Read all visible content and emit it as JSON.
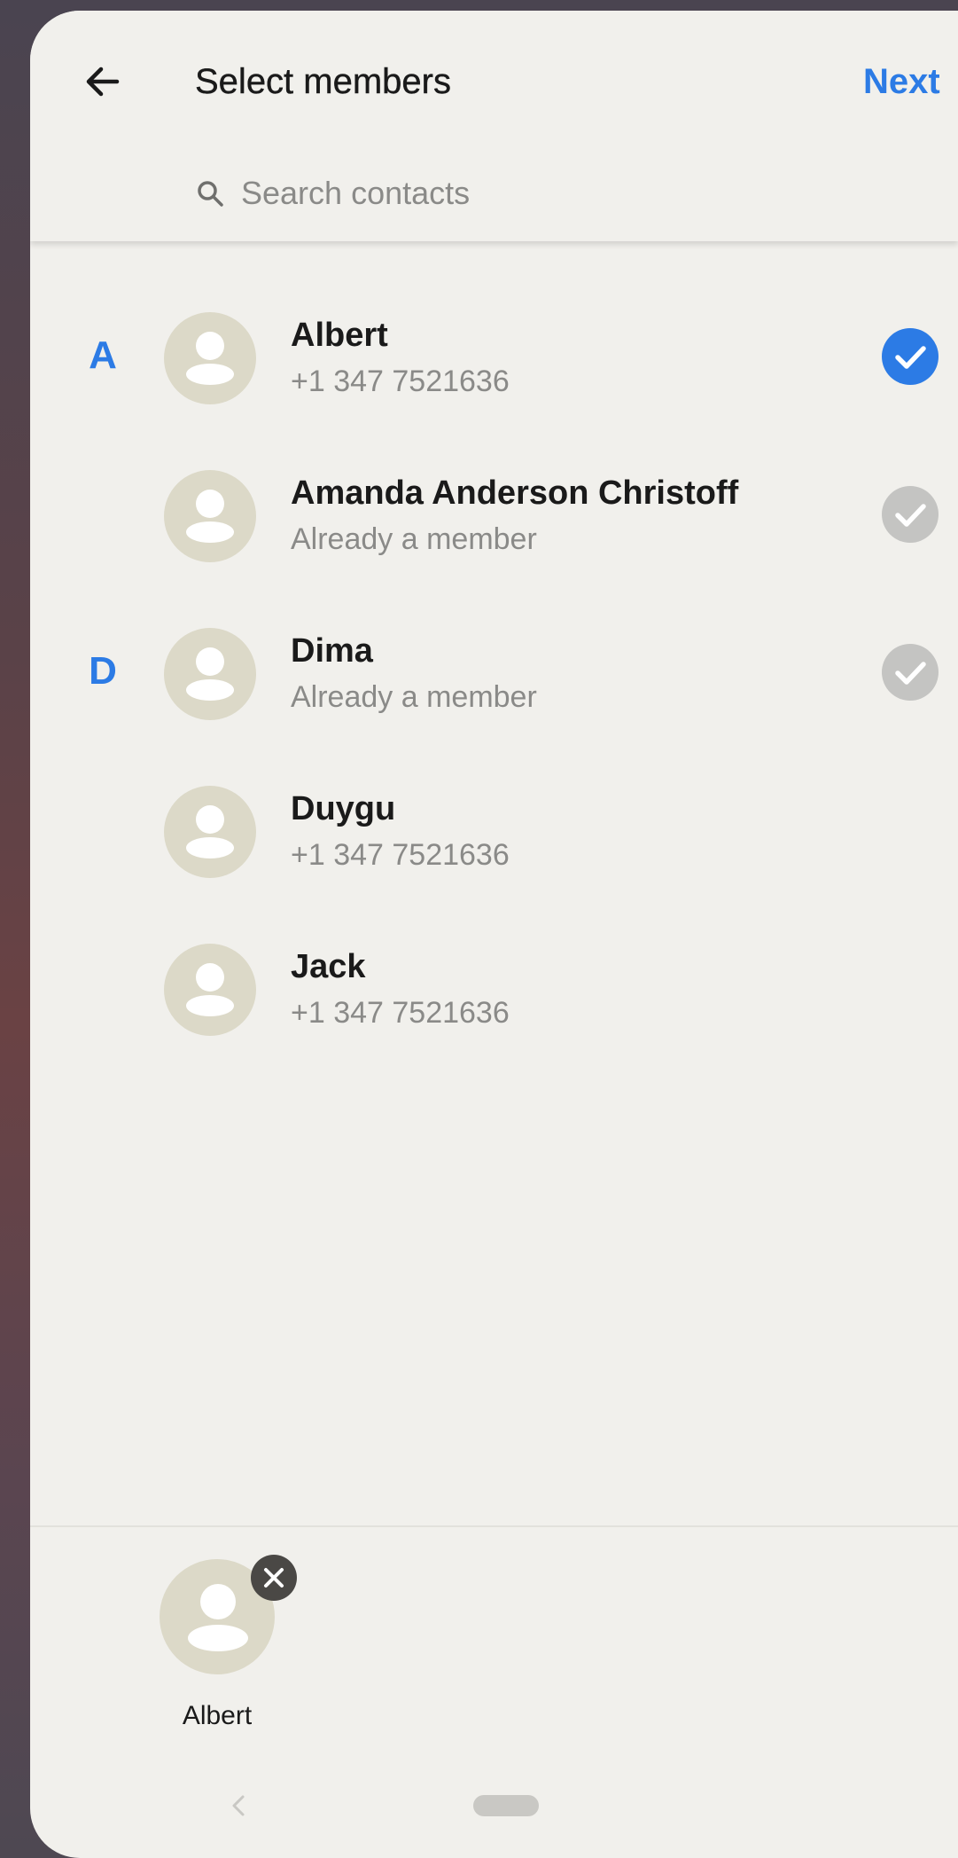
{
  "header": {
    "title": "Select members",
    "next_label": "Next",
    "search_placeholder": "Search contacts"
  },
  "sections": [
    {
      "letter": "A"
    },
    {
      "letter": "D"
    }
  ],
  "contacts": [
    {
      "name": "Albert",
      "subtitle": "+1 347 7521636",
      "state": "selected"
    },
    {
      "name": "Amanda Anderson Christoff",
      "subtitle": "Already a member",
      "state": "member"
    },
    {
      "name": "Dima",
      "subtitle": "Already a member",
      "state": "member"
    },
    {
      "name": "Duygu",
      "subtitle": "+1 347 7521636",
      "state": "none"
    },
    {
      "name": "Jack",
      "subtitle": "+1 347 7521636",
      "state": "none"
    }
  ],
  "selected_tray": {
    "items": [
      {
        "name": "Albert"
      }
    ]
  },
  "colors": {
    "accent": "#2c7be5",
    "member_check": "#c4c4c2",
    "avatar": "#dcd9c8",
    "background": "#f1f0ec"
  },
  "icons": {
    "back": "arrow-left-icon",
    "search": "search-icon",
    "selected": "check-circle-icon",
    "member": "check-circle-icon",
    "remove": "close-circle-icon",
    "nav_back": "chevron-left-icon"
  }
}
